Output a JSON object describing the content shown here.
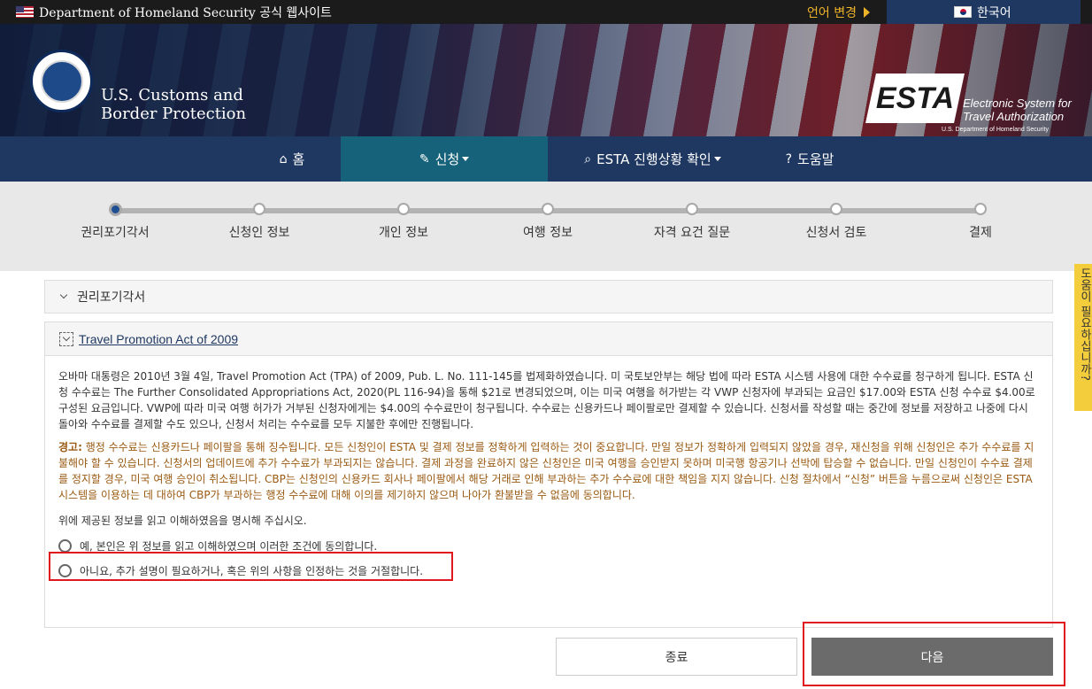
{
  "topbar": {
    "official": "Department of Homeland Security 공식 웹사이트",
    "language_change": "언어 변경",
    "current_language": "한국어"
  },
  "header": {
    "agency_line1": "U.S. Customs and",
    "agency_line2": "Border Protection",
    "esta_logo": "ESTA",
    "esta_line1": "Electronic System for",
    "esta_line2": "Travel Authorization",
    "esta_sub": "U.S. Department of Homeland Security"
  },
  "nav": {
    "home": "홈",
    "apply": "신청",
    "status": "ESTA 진행상황 확인",
    "help": "도움말"
  },
  "progress": {
    "steps": [
      "권리포기각서",
      "신청인 정보",
      "개인 정보",
      "여행 정보",
      "자격 요건 질문",
      "신청서 검토",
      "결제"
    ],
    "current": 0
  },
  "side_tab": "도움이 필요하십니까?",
  "panel1": {
    "title": "권리포기각서"
  },
  "panel2": {
    "title": "Travel Promotion Act of 2009",
    "paragraph": "오바마 대통령은 2010년 3월 4일, Travel Promotion Act (TPA) of 2009, Pub. L. No. 111-145를 법제화하였습니다. 미 국토보안부는 해당 법에 따라 ESTA 시스템 사용에 대한 수수료를 청구하게 됩니다. ESTA 신청 수수료는 The Further Consolidated Appropriations Act, 2020(PL 116-94)을 통해 $21로 변경되었으며, 이는 미국 여행을 허가받는 각 VWP 신청자에 부과되는 요금인 $17.00와 ESTA 신청 수수료 $4.00로 구성된 요금입니다. VWP에 따라 미국 여행 허가가 거부된 신청자에게는 $4.00의 수수료만이 청구됩니다. 수수료는 신용카드나 페이팔로만 결제할 수 있습니다. 신청서를 작성할 때는 중간에 정보를 저장하고 나중에 다시 돌아와 수수료를 결제할 수도 있으나, 신청서 처리는 수수료를 모두 지불한 후에만 진행됩니다.",
    "warning_label": "경고:",
    "warning_text": " 행정 수수료는 신용카드나 페이팔을 통해 징수됩니다. 모든 신청인이 ESTA 및 결제 정보를 정확하게 입력하는 것이 중요합니다. 만일 정보가 정확하게 입력되지 않았을 경우, 재신청을 위해 신청인은 추가 수수료를 지불해야 할 수 있습니다. 신청서의 업데이트에 추가 수수료가 부과되지는 않습니다. 결제 과정을 완료하지 않은 신청인은 미국 여행을 승인받지 못하며 미국행 항공기나 선박에 탑승할 수 없습니다. 만일 신청인이 수수료 결제를 정지할 경우, 미국 여행 승인이 취소됩니다. CBP는 신청인의 신용카드 회사나 페이팔에서 해당 거래로 인해 부과하는 추가 수수료에 대한 책임을 지지 않습니다. 신청 절차에서 “신청” 버튼을 누름으로써 신청인은 ESTA 시스템을 이용하는 데 대하여 CBP가 부과하는 행정 수수료에 대해 이의를 제기하지 않으며 나아가 환불받을 수 없음에 동의합니다.",
    "ask": "위에 제공된 정보를 읽고 이해하였음을 명시해 주십시오.",
    "option_yes": "예, 본인은 위 정보를 읽고 이해하였으며 이러한 조건에 동의합니다.",
    "option_no": "아니요, 추가 설명이 필요하거나, 혹은 위의 사항을 인정하는 것을 거절합니다."
  },
  "buttons": {
    "exit": "종료",
    "next": "다음"
  },
  "colors": {
    "nav_bg": "#1f3862",
    "nav_active": "#16627a",
    "warning_text": "#9a5a12",
    "highlight": "#e0191f",
    "next_button": "#6b6b6b"
  }
}
